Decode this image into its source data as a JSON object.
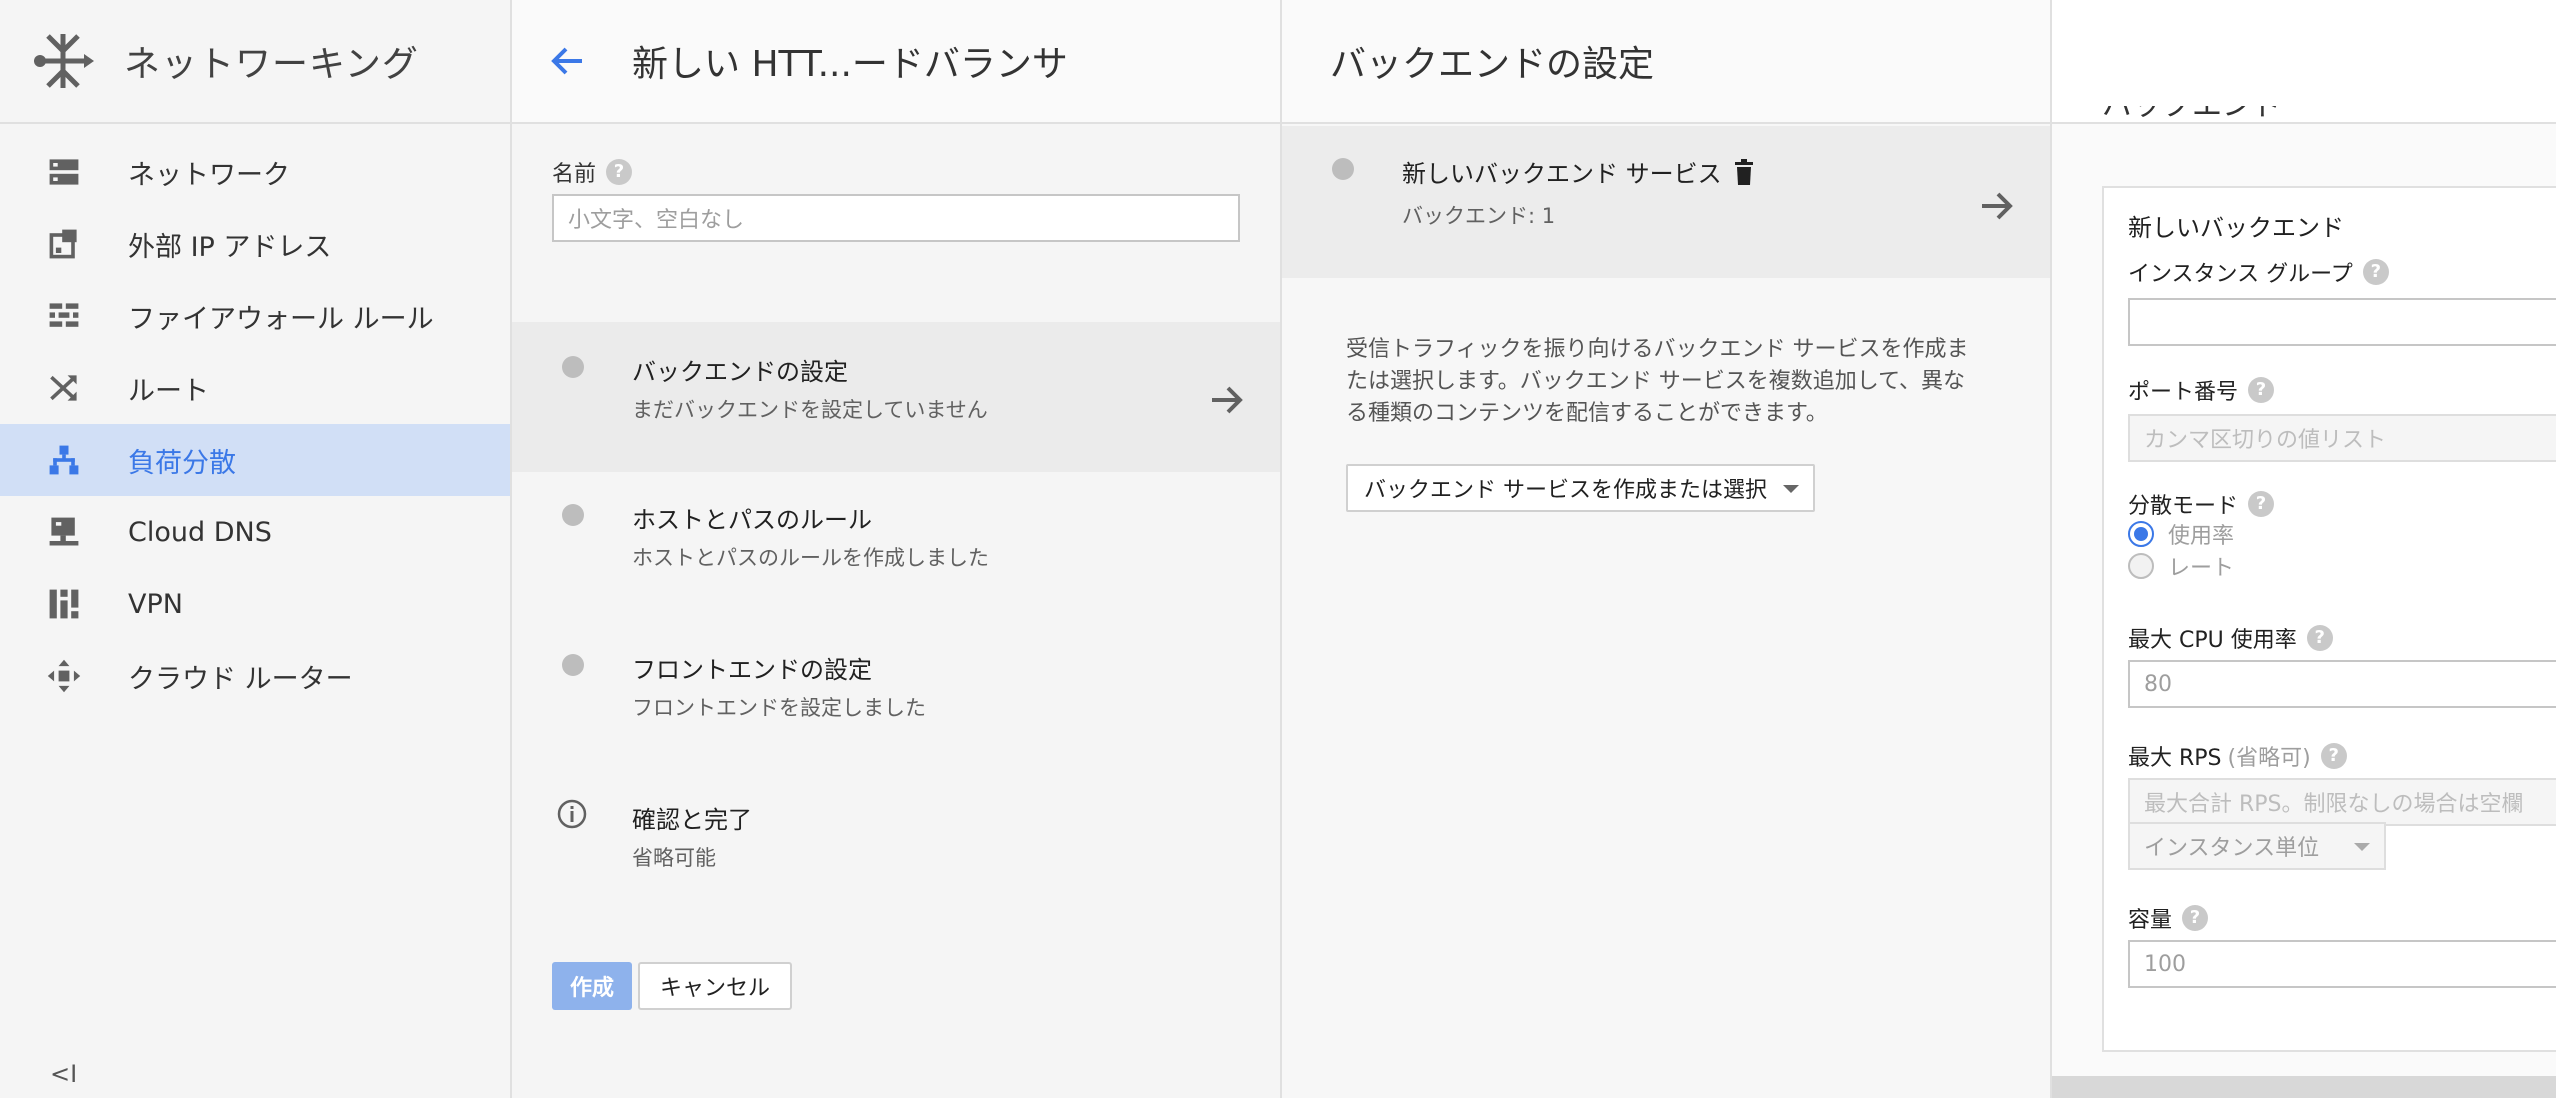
{
  "nav": {
    "title": "ネットワーキング",
    "items": [
      {
        "label": "ネットワーク",
        "icon": "network-icon"
      },
      {
        "label": "外部 IP アドレス",
        "icon": "external-ip-icon"
      },
      {
        "label": "ファイアウォール ルール",
        "icon": "firewall-icon"
      },
      {
        "label": "ルート",
        "icon": "routes-icon"
      },
      {
        "label": "負荷分散",
        "icon": "load-balancing-icon",
        "active": true
      },
      {
        "label": "Cloud DNS",
        "icon": "cloud-dns-icon"
      },
      {
        "label": "VPN",
        "icon": "vpn-icon"
      },
      {
        "label": "クラウド ルーター",
        "icon": "cloud-router-icon"
      }
    ],
    "collapse_label": "<I"
  },
  "wizard": {
    "title": "新しい HTT...ードバランサ",
    "name_label": "名前",
    "name_placeholder": "小文字、空白なし",
    "steps": [
      {
        "title": "バックエンドの設定",
        "subtitle": "まだバックエンドを設定していません"
      },
      {
        "title": "ホストとパスのルール",
        "subtitle": "ホストとパスのルールを作成しました"
      },
      {
        "title": "フロントエンドの設定",
        "subtitle": "フロントエンドを設定しました"
      },
      {
        "title": "確認と完了",
        "subtitle": "省略可能"
      }
    ],
    "create_label": "作成",
    "cancel_label": "キャンセル"
  },
  "backend": {
    "title": "バックエンドの設定",
    "service_title": "新しいバックエンド サービス",
    "service_sub": "バックエンド: 1",
    "description": "受信トラフィックを振り向けるバックエンド サービスを作成または選択します。バックエンド サービスを複数追加して、異なる種類のコンテンツを配信することができます。",
    "dropdown_label": "バックエンド サービスを作成または選択"
  },
  "new_backend": {
    "section_heading": "バックエンド",
    "card_title": "新しいバックエンド",
    "instance_group_label": "インスタンス グループ",
    "instance_group_value": "",
    "port_label": "ポート番号",
    "port_placeholder": "カンマ区切りの値リスト",
    "mode_label": "分散モード",
    "mode_options": [
      "使用率",
      "レート"
    ],
    "mode_selected": "使用率",
    "max_cpu_label": "最大 CPU 使用率",
    "max_cpu_value": "80",
    "max_rps_label": "最大 RPS",
    "max_rps_optional": "(省略可)",
    "max_rps_placeholder": "最大合計 RPS。制限なしの場合は空欄",
    "rps_unit": "インスタンス単位",
    "capacity_label": "容量",
    "capacity_value": "100"
  },
  "colors": {
    "accent": "#3b78e7",
    "active_nav_bg": "#d1dff6",
    "primary_button": "#8eb2ec"
  }
}
